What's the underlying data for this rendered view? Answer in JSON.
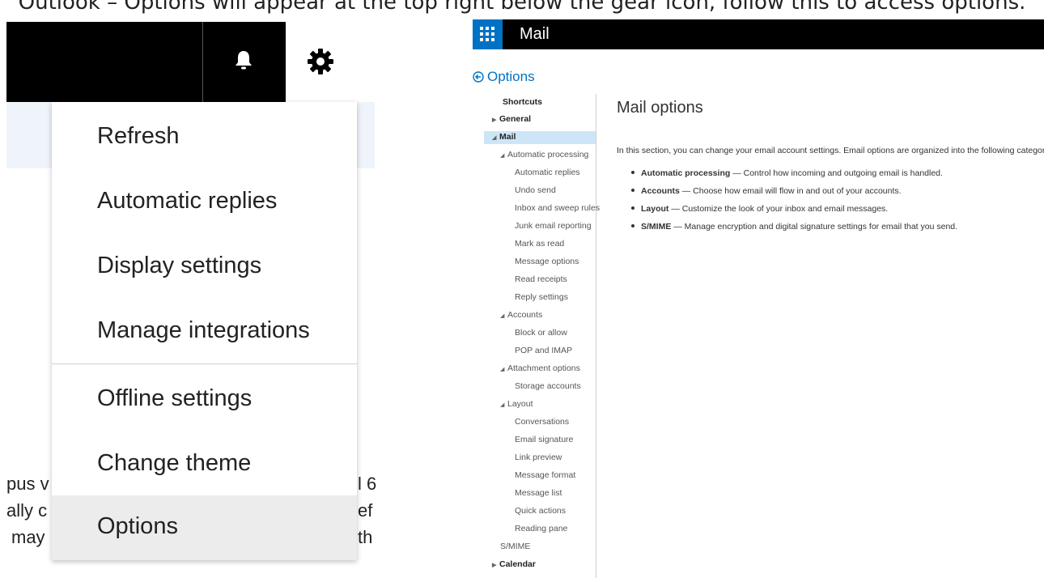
{
  "top_caption": "Outlook – Options will appear at the top right below the gear icon, follow this to access options.",
  "left": {
    "behind_text": [
      "pus v",
      "ally c",
      "may",
      "l 6",
      "ef",
      "th"
    ],
    "menu": [
      {
        "label": "Refresh"
      },
      {
        "label": "Automatic replies"
      },
      {
        "label": "Display settings"
      },
      {
        "label": "Manage integrations"
      },
      {
        "label": "Offline settings"
      },
      {
        "label": "Change theme"
      },
      {
        "label": "Options"
      }
    ]
  },
  "right": {
    "app_title": "Mail",
    "back_label": "Options",
    "nav": [
      {
        "label": "Shortcuts"
      },
      {
        "label": "General"
      },
      {
        "label": "Mail"
      },
      {
        "label": "Automatic processing"
      },
      {
        "label": "Automatic replies"
      },
      {
        "label": "Undo send"
      },
      {
        "label": "Inbox and sweep rules"
      },
      {
        "label": "Junk email reporting"
      },
      {
        "label": "Mark as read"
      },
      {
        "label": "Message options"
      },
      {
        "label": "Read receipts"
      },
      {
        "label": "Reply settings"
      },
      {
        "label": "Accounts"
      },
      {
        "label": "Block or allow"
      },
      {
        "label": "POP and IMAP"
      },
      {
        "label": "Attachment options"
      },
      {
        "label": "Storage accounts"
      },
      {
        "label": "Layout"
      },
      {
        "label": "Conversations"
      },
      {
        "label": "Email signature"
      },
      {
        "label": "Link preview"
      },
      {
        "label": "Message format"
      },
      {
        "label": "Message list"
      },
      {
        "label": "Quick actions"
      },
      {
        "label": "Reading pane"
      },
      {
        "label": "S/MIME"
      },
      {
        "label": "Calendar"
      }
    ],
    "heading": "Mail options",
    "intro": "In this section, you can change your email account settings. Email options are organized into the following categories:",
    "bullets": [
      {
        "term": "Automatic processing",
        "desc": " — Control how incoming and outgoing email is handled."
      },
      {
        "term": "Accounts",
        "desc": " — Choose how email will flow in and out of your accounts."
      },
      {
        "term": "Layout",
        "desc": " — Customize the look of your inbox and email messages."
      },
      {
        "term": "S/MIME",
        "desc": " — Manage encryption and digital signature settings for email that you send."
      }
    ]
  }
}
